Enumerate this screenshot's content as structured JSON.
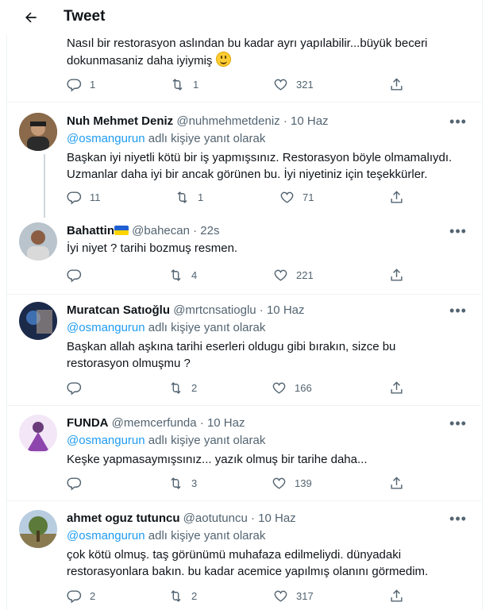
{
  "header": {
    "title": "Tweet"
  },
  "top_tweet": {
    "text_line1": "Nasıl bir restorasyon aslından bu kadar ayrı yapılabilir...büyük beceri",
    "text_line2": "dokunmasaniz daha iyiymiş",
    "replies": "1",
    "retweets": "1",
    "likes": "321"
  },
  "tweets": [
    {
      "name": "Nuh Mehmet Deniz",
      "handle": "@nuhmehmetdeniz",
      "sep": "·",
      "time": "10 Haz",
      "reply_to": "@osmangurun",
      "reply_suffix": " adlı kişiye yanıt olarak",
      "text": "Başkan iyi niyetli kötü bir iş yapmışsınız. Restorasyon böyle olmamalıydı. Uzmanlar daha iyi bir ancak görünen bu. İyi niyetiniz için teşekkürler.",
      "replies": "11",
      "retweets": "1",
      "likes": "71"
    },
    {
      "name": "Bahattin",
      "handle": "@bahecan",
      "sep": "·",
      "time": "22s",
      "text": "İyi niyet ? tarihi bozmuş resmen.",
      "replies": "",
      "retweets": "4",
      "likes": "221"
    },
    {
      "name": "Muratcan Satıoğlu",
      "handle": "@mrtcnsatioglu",
      "sep": "·",
      "time": "10 Haz",
      "reply_to": "@osmangurun",
      "reply_suffix": " adlı kişiye yanıt olarak",
      "text": "Başkan allah aşkına tarihi eserleri oldugu gibi bırakın, sizce bu restorasyon olmuşmu ?",
      "replies": "",
      "retweets": "2",
      "likes": "166"
    },
    {
      "name": "FUNDA",
      "handle": "@memcerfunda",
      "sep": "·",
      "time": "10 Haz",
      "reply_to": "@osmangurun",
      "reply_suffix": " adlı kişiye yanıt olarak",
      "text": "Keşke yapmasaymışsınız... yazık olmuş bir tarihe daha...",
      "replies": "",
      "retweets": "3",
      "likes": "139"
    },
    {
      "name": "ahmet oguz tutuncu",
      "handle": "@aotutuncu",
      "sep": "·",
      "time": "10 Haz",
      "reply_to": "@osmangurun",
      "reply_suffix": " adlı kişiye yanıt olarak",
      "text": "çok kötü olmuş. taş görünümü muhafaza edilmeliydi. dünyadaki restorasyonlara bakın. bu kadar acemice yapılmış olanını görmedim.",
      "replies": "2",
      "retweets": "2",
      "likes": "317"
    }
  ],
  "icons": [
    "back-arrow-icon",
    "more-icon",
    "reply-icon",
    "retweet-icon",
    "like-icon",
    "share-icon",
    "ukraine-flag-icon",
    "smiley-emoji-icon"
  ],
  "colors": {
    "link": "#1d9bf0",
    "muted": "#536471",
    "text": "#0f1419",
    "border": "#eff3f4"
  }
}
